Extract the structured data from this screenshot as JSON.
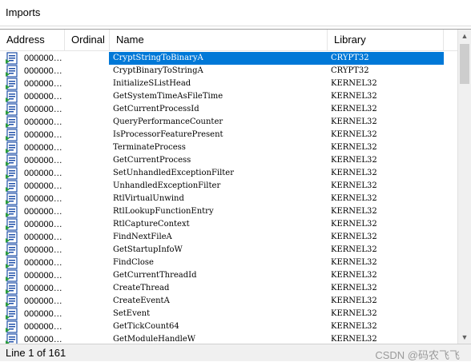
{
  "window": {
    "title": "Imports"
  },
  "columns": {
    "address": "Address",
    "ordinal": "Ordinal",
    "name": "Name",
    "library": "Library"
  },
  "rows": [
    {
      "address": "000000…",
      "name": "CryptStringToBinaryA",
      "library": "CRYPT32",
      "selected": true
    },
    {
      "address": "000000…",
      "name": "CryptBinaryToStringA",
      "library": "CRYPT32"
    },
    {
      "address": "000000…",
      "name": "InitializeSListHead",
      "library": "KERNEL32"
    },
    {
      "address": "000000…",
      "name": "GetSystemTimeAsFileTime",
      "library": "KERNEL32"
    },
    {
      "address": "000000…",
      "name": "GetCurrentProcessId",
      "library": "KERNEL32"
    },
    {
      "address": "000000…",
      "name": "QueryPerformanceCounter",
      "library": "KERNEL32"
    },
    {
      "address": "000000…",
      "name": "IsProcessorFeaturePresent",
      "library": "KERNEL32"
    },
    {
      "address": "000000…",
      "name": "TerminateProcess",
      "library": "KERNEL32"
    },
    {
      "address": "000000…",
      "name": "GetCurrentProcess",
      "library": "KERNEL32"
    },
    {
      "address": "000000…",
      "name": "SetUnhandledExceptionFilter",
      "library": "KERNEL32"
    },
    {
      "address": "000000…",
      "name": "UnhandledExceptionFilter",
      "library": "KERNEL32"
    },
    {
      "address": "000000…",
      "name": "RtlVirtualUnwind",
      "library": "KERNEL32"
    },
    {
      "address": "000000…",
      "name": "RtlLookupFunctionEntry",
      "library": "KERNEL32"
    },
    {
      "address": "000000…",
      "name": "RtlCaptureContext",
      "library": "KERNEL32"
    },
    {
      "address": "000000…",
      "name": "FindNextFileA",
      "library": "KERNEL32"
    },
    {
      "address": "000000…",
      "name": "GetStartupInfoW",
      "library": "KERNEL32"
    },
    {
      "address": "000000…",
      "name": "FindClose",
      "library": "KERNEL32"
    },
    {
      "address": "000000…",
      "name": "GetCurrentThreadId",
      "library": "KERNEL32"
    },
    {
      "address": "000000…",
      "name": "CreateThread",
      "library": "KERNEL32"
    },
    {
      "address": "000000…",
      "name": "CreateEventA",
      "library": "KERNEL32"
    },
    {
      "address": "000000…",
      "name": "SetEvent",
      "library": "KERNEL32"
    },
    {
      "address": "000000…",
      "name": "GetTickCount64",
      "library": "KERNEL32"
    },
    {
      "address": "000000…",
      "name": "GetModuleHandleW",
      "library": "KERNEL32"
    }
  ],
  "status": {
    "text": "Line 1 of 161",
    "watermark": "CSDN @码农飞飞"
  },
  "colors": {
    "selection": "#0078d7",
    "icon_blue": "#1e4fa8",
    "icon_green": "#2e9e3e"
  },
  "icons": {
    "row": "import-function-icon"
  }
}
